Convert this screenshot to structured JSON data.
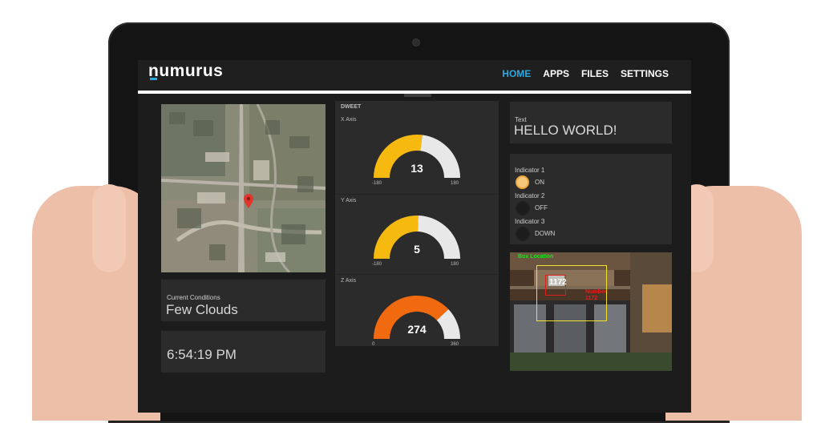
{
  "app": {
    "logo": "numurus"
  },
  "nav": {
    "items": [
      {
        "label": "HOME",
        "active": true
      },
      {
        "label": "APPS",
        "active": false
      },
      {
        "label": "FILES",
        "active": false
      },
      {
        "label": "SETTINGS",
        "active": false
      }
    ]
  },
  "weather": {
    "label": "Current Conditions",
    "value": "Few Clouds"
  },
  "clock": {
    "value": "6:54:19 PM"
  },
  "dweet": {
    "title": "DWEET",
    "gauges": [
      {
        "label": "X Axis",
        "value": "13",
        "min": "-180",
        "max": "180",
        "fraction": 0.54,
        "color": "#f5b90f"
      },
      {
        "label": "Y Axis",
        "value": "5",
        "min": "-180",
        "max": "180",
        "fraction": 0.51,
        "color": "#f5b90f"
      },
      {
        "label": "Z Axis",
        "value": "274",
        "min": "0",
        "max": "360",
        "fraction": 0.76,
        "color": "#f26a10"
      }
    ]
  },
  "text_widget": {
    "label": "Text",
    "value": "HELLO WORLD!"
  },
  "indicators": [
    {
      "label": "Indicator 1",
      "state": "ON",
      "lit": true
    },
    {
      "label": "Indicator 2",
      "state": "OFF",
      "lit": false
    },
    {
      "label": "Indicator 3",
      "state": "DOWN",
      "lit": false
    }
  ],
  "detection": {
    "box_label": "Box Location",
    "sign_text": "1172",
    "number_label": "Number:",
    "number_value": "1172"
  },
  "colors": {
    "accent": "#29a9e1",
    "gauge_track": "#e8e8e8",
    "indicator_on": "#f6c77a"
  }
}
